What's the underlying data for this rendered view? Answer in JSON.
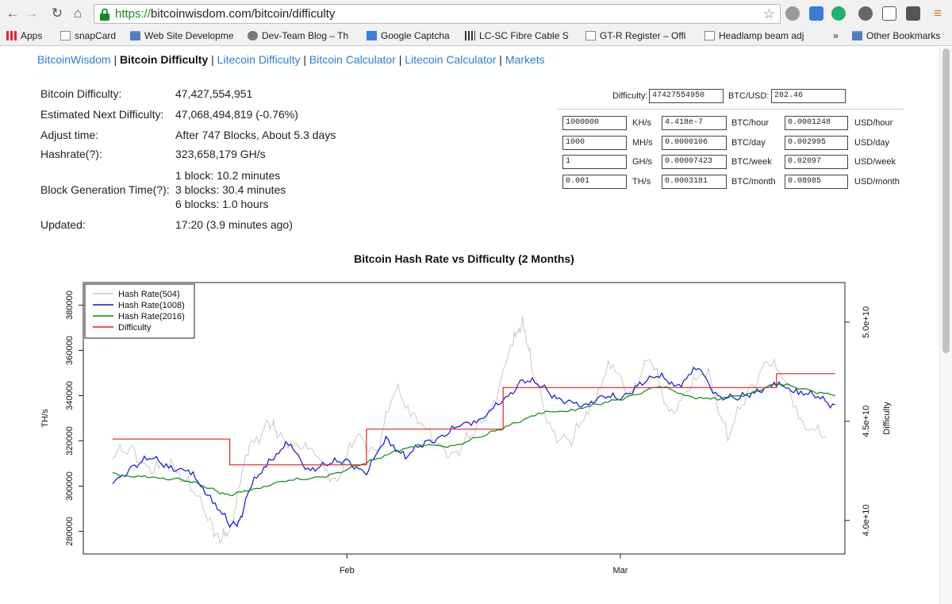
{
  "browser": {
    "url_scheme": "https://",
    "url_rest": "bitcoinwisdom.com/bitcoin/difficulty",
    "bookmarks": [
      {
        "label": "Apps",
        "icon": "apps-grid-icon"
      },
      {
        "label": "snapCard",
        "icon": "page-icon"
      },
      {
        "label": "Web Site Developme",
        "icon": "folder-icon"
      },
      {
        "label": "Dev-Team Blog – Th",
        "icon": "blog-icon"
      },
      {
        "label": "Google Captcha",
        "icon": "google-icon"
      },
      {
        "label": "LC-SC Fibre Cable S",
        "icon": "cable-icon"
      },
      {
        "label": "GT-R Register – Offi",
        "icon": "page-icon"
      },
      {
        "label": "Headlamp beam adj",
        "icon": "page-icon"
      },
      {
        "label": "»",
        "icon": ""
      },
      {
        "label": "Other Bookmarks",
        "icon": "folder-icon"
      }
    ]
  },
  "nav": {
    "links": [
      "BitcoinWisdom",
      "Bitcoin Difficulty",
      "Litecoin Difficulty",
      "Bitcoin Calculator",
      "Litecoin Calculator",
      "Markets"
    ],
    "separator": " | "
  },
  "stats": {
    "difficulty_label": "Bitcoin Difficulty:",
    "difficulty_value": "47,427,554,951",
    "next_label": "Estimated Next Difficulty:",
    "next_value": "47,068,494,819 (-0.76%)",
    "adjust_label": "Adjust time:",
    "adjust_value": "After 747 Blocks, About 5.3 days",
    "hashrate_label": "Hashrate(?):",
    "hashrate_value": "323,658,179 GH/s",
    "blockgen_label": "Block Generation Time(?):",
    "blockgen_values": [
      "1 block: 10.2 minutes",
      "3 blocks: 30.4 minutes",
      "6 blocks: 1.0 hours"
    ],
    "updated_label": "Updated:",
    "updated_value": "17:20 (3.9 minutes ago)"
  },
  "calculator": {
    "difficulty_label": "Difficulty:",
    "difficulty_value": "47427554950",
    "btcusd_label": "BTC/USD:",
    "btcusd_value": "282.46",
    "rows": [
      {
        "hash": "1000000",
        "hash_unit": "KH/s",
        "btc": "4.418e-7",
        "btc_unit": "BTC/hour",
        "usd": "0.0001248",
        "usd_unit": "USD/hour"
      },
      {
        "hash": "1000",
        "hash_unit": "MH/s",
        "btc": "0.0000106",
        "btc_unit": "BTC/day",
        "usd": "0.002995",
        "usd_unit": "USD/day"
      },
      {
        "hash": "1",
        "hash_unit": "GH/s",
        "btc": "0.00007423",
        "btc_unit": "BTC/week",
        "usd": "0.02097",
        "usd_unit": "USD/week"
      },
      {
        "hash": "0.001",
        "hash_unit": "TH/s",
        "btc": "0.0003181",
        "btc_unit": "BTC/month",
        "usd": "0.08985",
        "usd_unit": "USD/month"
      }
    ]
  },
  "chart_data": {
    "type": "line",
    "title": "Bitcoin Hash Rate vs Difficulty (2 Months)",
    "ylabel": "TH/s",
    "y2label": "Difficulty",
    "ylim": [
      270000,
      390000
    ],
    "y2lim": [
      38300000000,
      52000000000
    ],
    "yticks": [
      280000,
      300000,
      320000,
      340000,
      360000,
      380000
    ],
    "yticklabels": [
      "280000",
      "300000",
      "320000",
      "340000",
      "360000",
      "380000"
    ],
    "y2ticks": [
      40000000000,
      45000000000,
      50000000000
    ],
    "y2ticklabels": [
      "4.0e+10",
      "4.5e+10",
      "5.0e+10"
    ],
    "xlim": [
      "2015-01-05",
      "2015-03-24"
    ],
    "xticks": [
      "2015-02-01",
      "2015-03-01"
    ],
    "xticklabels": [
      "Feb",
      "Mar"
    ],
    "legend": [
      "Hash Rate(504)",
      "Hash Rate(1008)",
      "Hash Rate(2016)",
      "Difficulty"
    ],
    "legend_position": "top-left",
    "colors": {
      "hash504": "#c8c8c8",
      "hash1008": "#1010e0",
      "hash2016": "#0a8a0a",
      "difficulty": "#e02020"
    },
    "series": [
      {
        "name": "Hash Rate(504)",
        "x": [
          "2015-01-08",
          "2015-01-10",
          "2015-01-12",
          "2015-01-14",
          "2015-01-16",
          "2015-01-18",
          "2015-01-19",
          "2015-01-20",
          "2015-01-21",
          "2015-01-22",
          "2015-01-24",
          "2015-01-25",
          "2015-01-27",
          "2015-01-29",
          "2015-01-31",
          "2015-02-02",
          "2015-02-04",
          "2015-02-06",
          "2015-02-08",
          "2015-02-10",
          "2015-02-12",
          "2015-02-14",
          "2015-02-16",
          "2015-02-18",
          "2015-02-19",
          "2015-02-20",
          "2015-02-22",
          "2015-02-24",
          "2015-02-26",
          "2015-02-28",
          "2015-03-02",
          "2015-03-04",
          "2015-03-06",
          "2015-03-08",
          "2015-03-10",
          "2015-03-12",
          "2015-03-14",
          "2015-03-16",
          "2015-03-18",
          "2015-03-20",
          "2015-03-22"
        ],
        "values": [
          312000,
          318000,
          305000,
          312000,
          298000,
          286000,
          275000,
          280000,
          300000,
          318000,
          328000,
          322000,
          318000,
          313000,
          302000,
          322000,
          316000,
          342000,
          332000,
          318000,
          315000,
          322000,
          338000,
          362000,
          375000,
          350000,
          325000,
          318000,
          338000,
          352000,
          342000,
          356000,
          333000,
          342000,
          352000,
          320000,
          342000,
          355000,
          346000,
          325000,
          322000
        ]
      },
      {
        "name": "Hash Rate(1008)",
        "x": [
          "2015-01-08",
          "2015-01-10",
          "2015-01-12",
          "2015-01-14",
          "2015-01-16",
          "2015-01-18",
          "2015-01-20",
          "2015-01-21",
          "2015-01-22",
          "2015-01-24",
          "2015-01-26",
          "2015-01-28",
          "2015-01-30",
          "2015-02-01",
          "2015-02-03",
          "2015-02-05",
          "2015-02-07",
          "2015-02-09",
          "2015-02-11",
          "2015-02-13",
          "2015-02-15",
          "2015-02-17",
          "2015-02-19",
          "2015-02-21",
          "2015-02-23",
          "2015-02-25",
          "2015-02-27",
          "2015-03-01",
          "2015-03-03",
          "2015-03-05",
          "2015-03-07",
          "2015-03-09",
          "2015-03-11",
          "2015-03-13",
          "2015-03-15",
          "2015-03-17",
          "2015-03-19",
          "2015-03-21",
          "2015-03-23"
        ],
        "values": [
          301000,
          309000,
          312000,
          309000,
          305000,
          296000,
          282000,
          285000,
          298000,
          312000,
          318000,
          308000,
          309000,
          312000,
          305000,
          322000,
          312000,
          320000,
          322000,
          328000,
          330000,
          338000,
          347000,
          344000,
          338000,
          335000,
          340000,
          338000,
          346000,
          348000,
          345000,
          352000,
          340000,
          338000,
          343000,
          344000,
          343000,
          339000,
          336000
        ]
      },
      {
        "name": "Hash Rate(2016)",
        "x": [
          "2015-01-08",
          "2015-01-10",
          "2015-01-12",
          "2015-01-15",
          "2015-01-18",
          "2015-01-20",
          "2015-01-22",
          "2015-01-25",
          "2015-01-28",
          "2015-01-31",
          "2015-02-03",
          "2015-02-06",
          "2015-02-09",
          "2015-02-12",
          "2015-02-15",
          "2015-02-18",
          "2015-02-21",
          "2015-02-24",
          "2015-02-27",
          "2015-03-02",
          "2015-03-05",
          "2015-03-08",
          "2015-03-11",
          "2015-03-14",
          "2015-03-17",
          "2015-03-20",
          "2015-03-23"
        ],
        "values": [
          306000,
          304000,
          304000,
          303000,
          299000,
          296000,
          298000,
          302000,
          303000,
          306000,
          310000,
          316000,
          318000,
          318000,
          322000,
          328000,
          332000,
          334000,
          336000,
          340000,
          344000,
          340000,
          338000,
          341000,
          345000,
          343000,
          340000
        ]
      },
      {
        "name": "Difficulty",
        "x": [
          "2015-01-08",
          "2015-01-20",
          "2015-01-20",
          "2015-02-03",
          "2015-02-03",
          "2015-02-17",
          "2015-02-17",
          "2015-03-03",
          "2015-03-03",
          "2015-03-17",
          "2015-03-17",
          "2015-03-23"
        ],
        "values": [
          44100000000,
          44100000000,
          42800000000,
          42800000000,
          44600000000,
          44600000000,
          46700000000,
          46700000000,
          46700000000,
          46700000000,
          47400000000,
          47400000000
        ]
      }
    ]
  }
}
